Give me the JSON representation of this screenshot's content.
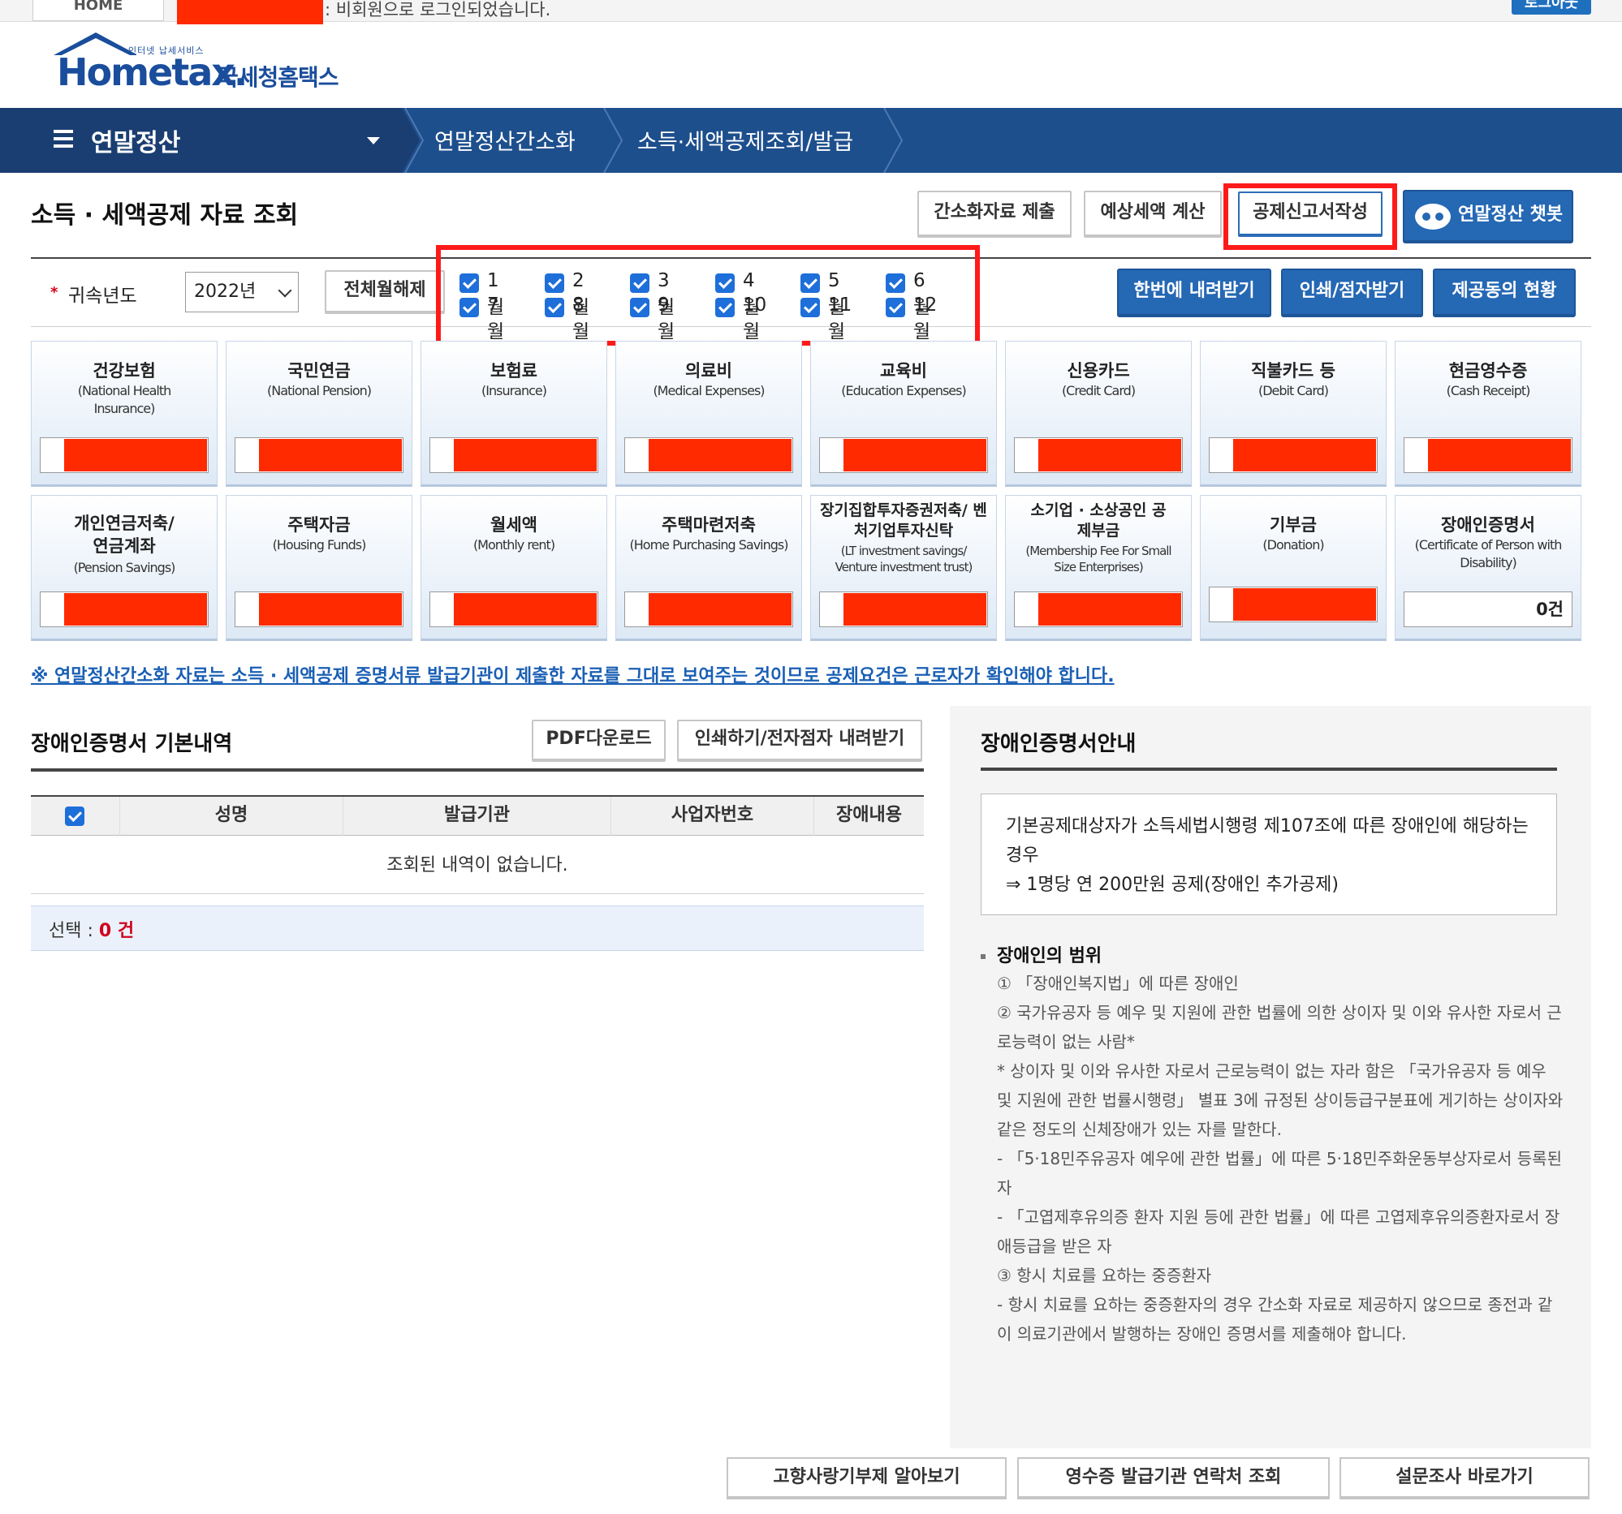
{
  "topbar": {
    "home": "HOME",
    "login_msg": ": 비회원으로 로그인되었습니다.",
    "logout": "로그아웃"
  },
  "logo": {
    "sub": "인터넷 납세서비스",
    "main": "Hometax.",
    "kr": "국세청홈택스"
  },
  "nav": {
    "menu_title": "연말정산",
    "crumbs": [
      "연말정산간소화",
      "소득·세액공제조회/발급"
    ]
  },
  "page": {
    "title": "소득 · 세액공제 자료 조회",
    "buttons": {
      "submit_simple": "간소화자료 제출",
      "estimate_tax": "예상세액 계산",
      "deduction_report": "공제신고서작성",
      "chatbot": "연말정산 챗봇"
    }
  },
  "filter": {
    "year_label": "귀속년도",
    "year_value": "2022년",
    "clear_all": "전체월해제",
    "months": [
      "1월",
      "2월",
      "3월",
      "4월",
      "5월",
      "6월",
      "7월",
      "8월",
      "9월",
      "10월",
      "11월",
      "12월"
    ],
    "download_all": "한번에 내려받기",
    "print_braille": "인쇄/점자받기",
    "consent_status": "제공동의 현황"
  },
  "cards": [
    {
      "title": "건강보험",
      "sub": "(National Health Insurance)"
    },
    {
      "title": "국민연금",
      "sub": "(National Pension)"
    },
    {
      "title": "보험료",
      "sub": "(Insurance)"
    },
    {
      "title": "의료비",
      "sub": "(Medical Expenses)"
    },
    {
      "title": "교육비",
      "sub": "(Education Expenses)"
    },
    {
      "title": "신용카드",
      "sub": "(Credit Card)"
    },
    {
      "title": "직불카드 등",
      "sub": "(Debit Card)"
    },
    {
      "title": "현금영수증",
      "sub": "(Cash Receipt)"
    },
    {
      "title": "개인연금저축/ 연금계좌",
      "sub": "(Pension Savings)"
    },
    {
      "title": "주택자금",
      "sub": "(Housing Funds)"
    },
    {
      "title": "월세액",
      "sub": "(Monthly rent)"
    },
    {
      "title": "주택마련저축",
      "sub": "(Home Purchasing Savings)"
    },
    {
      "title": "장기집합투자증권저축/ 벤처기업투자신탁",
      "sub": "(LT investment savings/ Venture investment trust)"
    },
    {
      "title": "소기업 · 소상공인 공제부금",
      "sub": "(Membership Fee For Small Size Enterprises)"
    },
    {
      "title": "기부금",
      "sub": "(Donation)"
    },
    {
      "title": "장애인증명서",
      "sub": "(Certificate of Person with Disability)",
      "value": "0건"
    }
  ],
  "notice": "※ 연말정산간소화 자료는 소득 · 세액공제 증명서류 발급기관이 제출한 자료를 그대로 보여주는 것이므로 공제요건은 근로자가 확인해야 합니다.",
  "left": {
    "title": "장애인증명서 기본내역",
    "pdf_btn": "PDF다운로드",
    "print_btn": "인쇄하기/전자점자 내려받기",
    "columns": [
      "성명",
      "발급기관",
      "사업자번호",
      "장애내용"
    ],
    "empty": "조회된 내역이 없습니다.",
    "sel_label": "선택 : ",
    "sel_count": "0 건"
  },
  "guide": {
    "title": "장애인증명서안내",
    "box_line1": "기본공제대상자가 소득세법시행령 제107조에 따른 장애인에 해당하는 경우",
    "box_line2": "⇒ 1명당 연 200만원 공제(장애인 추가공제)",
    "scope_title": "장애인의 범위",
    "scope_lines": [
      "① 「장애인복지법」에 따른 장애인",
      "② 국가유공자 등 예우 및 지원에 관한 법률에 의한 상이자 및 이와 유사한 자로서 근로능력이 없는 사람*",
      "* 상이자 및 이와 유사한 자로서 근로능력이 없는 자라 함은 「국가유공자 등 예우 및 지원에 관한 법률시행령」 별표 3에 규정된 상이등급구분표에 게기하는 상이자와 같은 정도의 신체장애가 있는 자를 말한다.",
      "- 「5·18민주유공자 예우에 관한 법률」에 따른 5·18민주화운동부상자로서 등록된 자",
      "- 「고엽제후유의증 환자 지원 등에 관한 법률」에 따른 고엽제후유의증환자로서 장애등급을 받은 자",
      "③ 항시 치료를 요하는 중증환자",
      "- 항시 치료를 요하는 중증환자의 경우 간소화 자료로 제공하지 않으므로 종전과 같이 의료기관에서 발행하는 장애인 증명서를 제출해야 합니다."
    ]
  },
  "bottom": {
    "hometown": "고향사랑기부제 알아보기",
    "receipt_contact": "영수증 발급기관 연락처 조회",
    "survey": "설문조사 바로가기"
  },
  "colors": {
    "nav": "#1e4f8d",
    "nav_dark": "#1a3e71",
    "accent_blue": "#2568b4",
    "highlight_red": "#ff1a1a",
    "redaction": "#ff2a00"
  }
}
